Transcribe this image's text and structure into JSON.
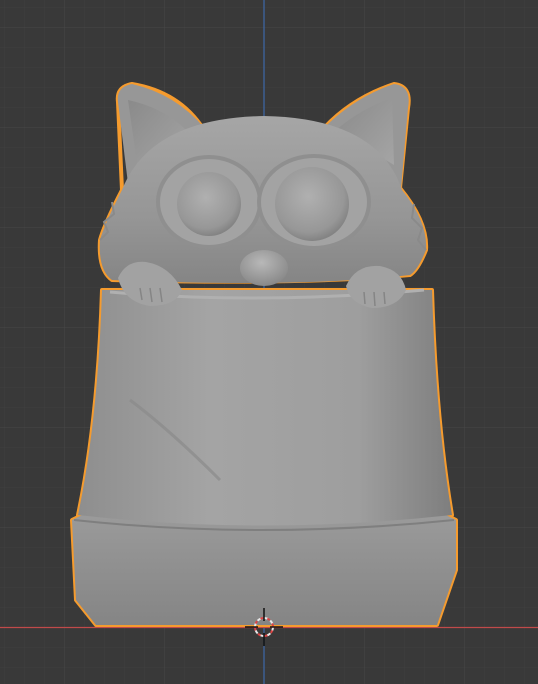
{
  "viewport": {
    "background_color": "#393939",
    "grid_minor_color": "#404040",
    "grid_major_color": "#4a4a4a",
    "x_axis_color": "#c04a4a",
    "z_axis_color": "#3d68a8",
    "selection_outline_color": "#f59b2e",
    "model_color": "#9a9a9a"
  },
  "scene": {
    "selected_object": {
      "selected": true,
      "description_icon": "cat-in-bed-mesh"
    },
    "cursor_icon": "3d-cursor-icon"
  }
}
